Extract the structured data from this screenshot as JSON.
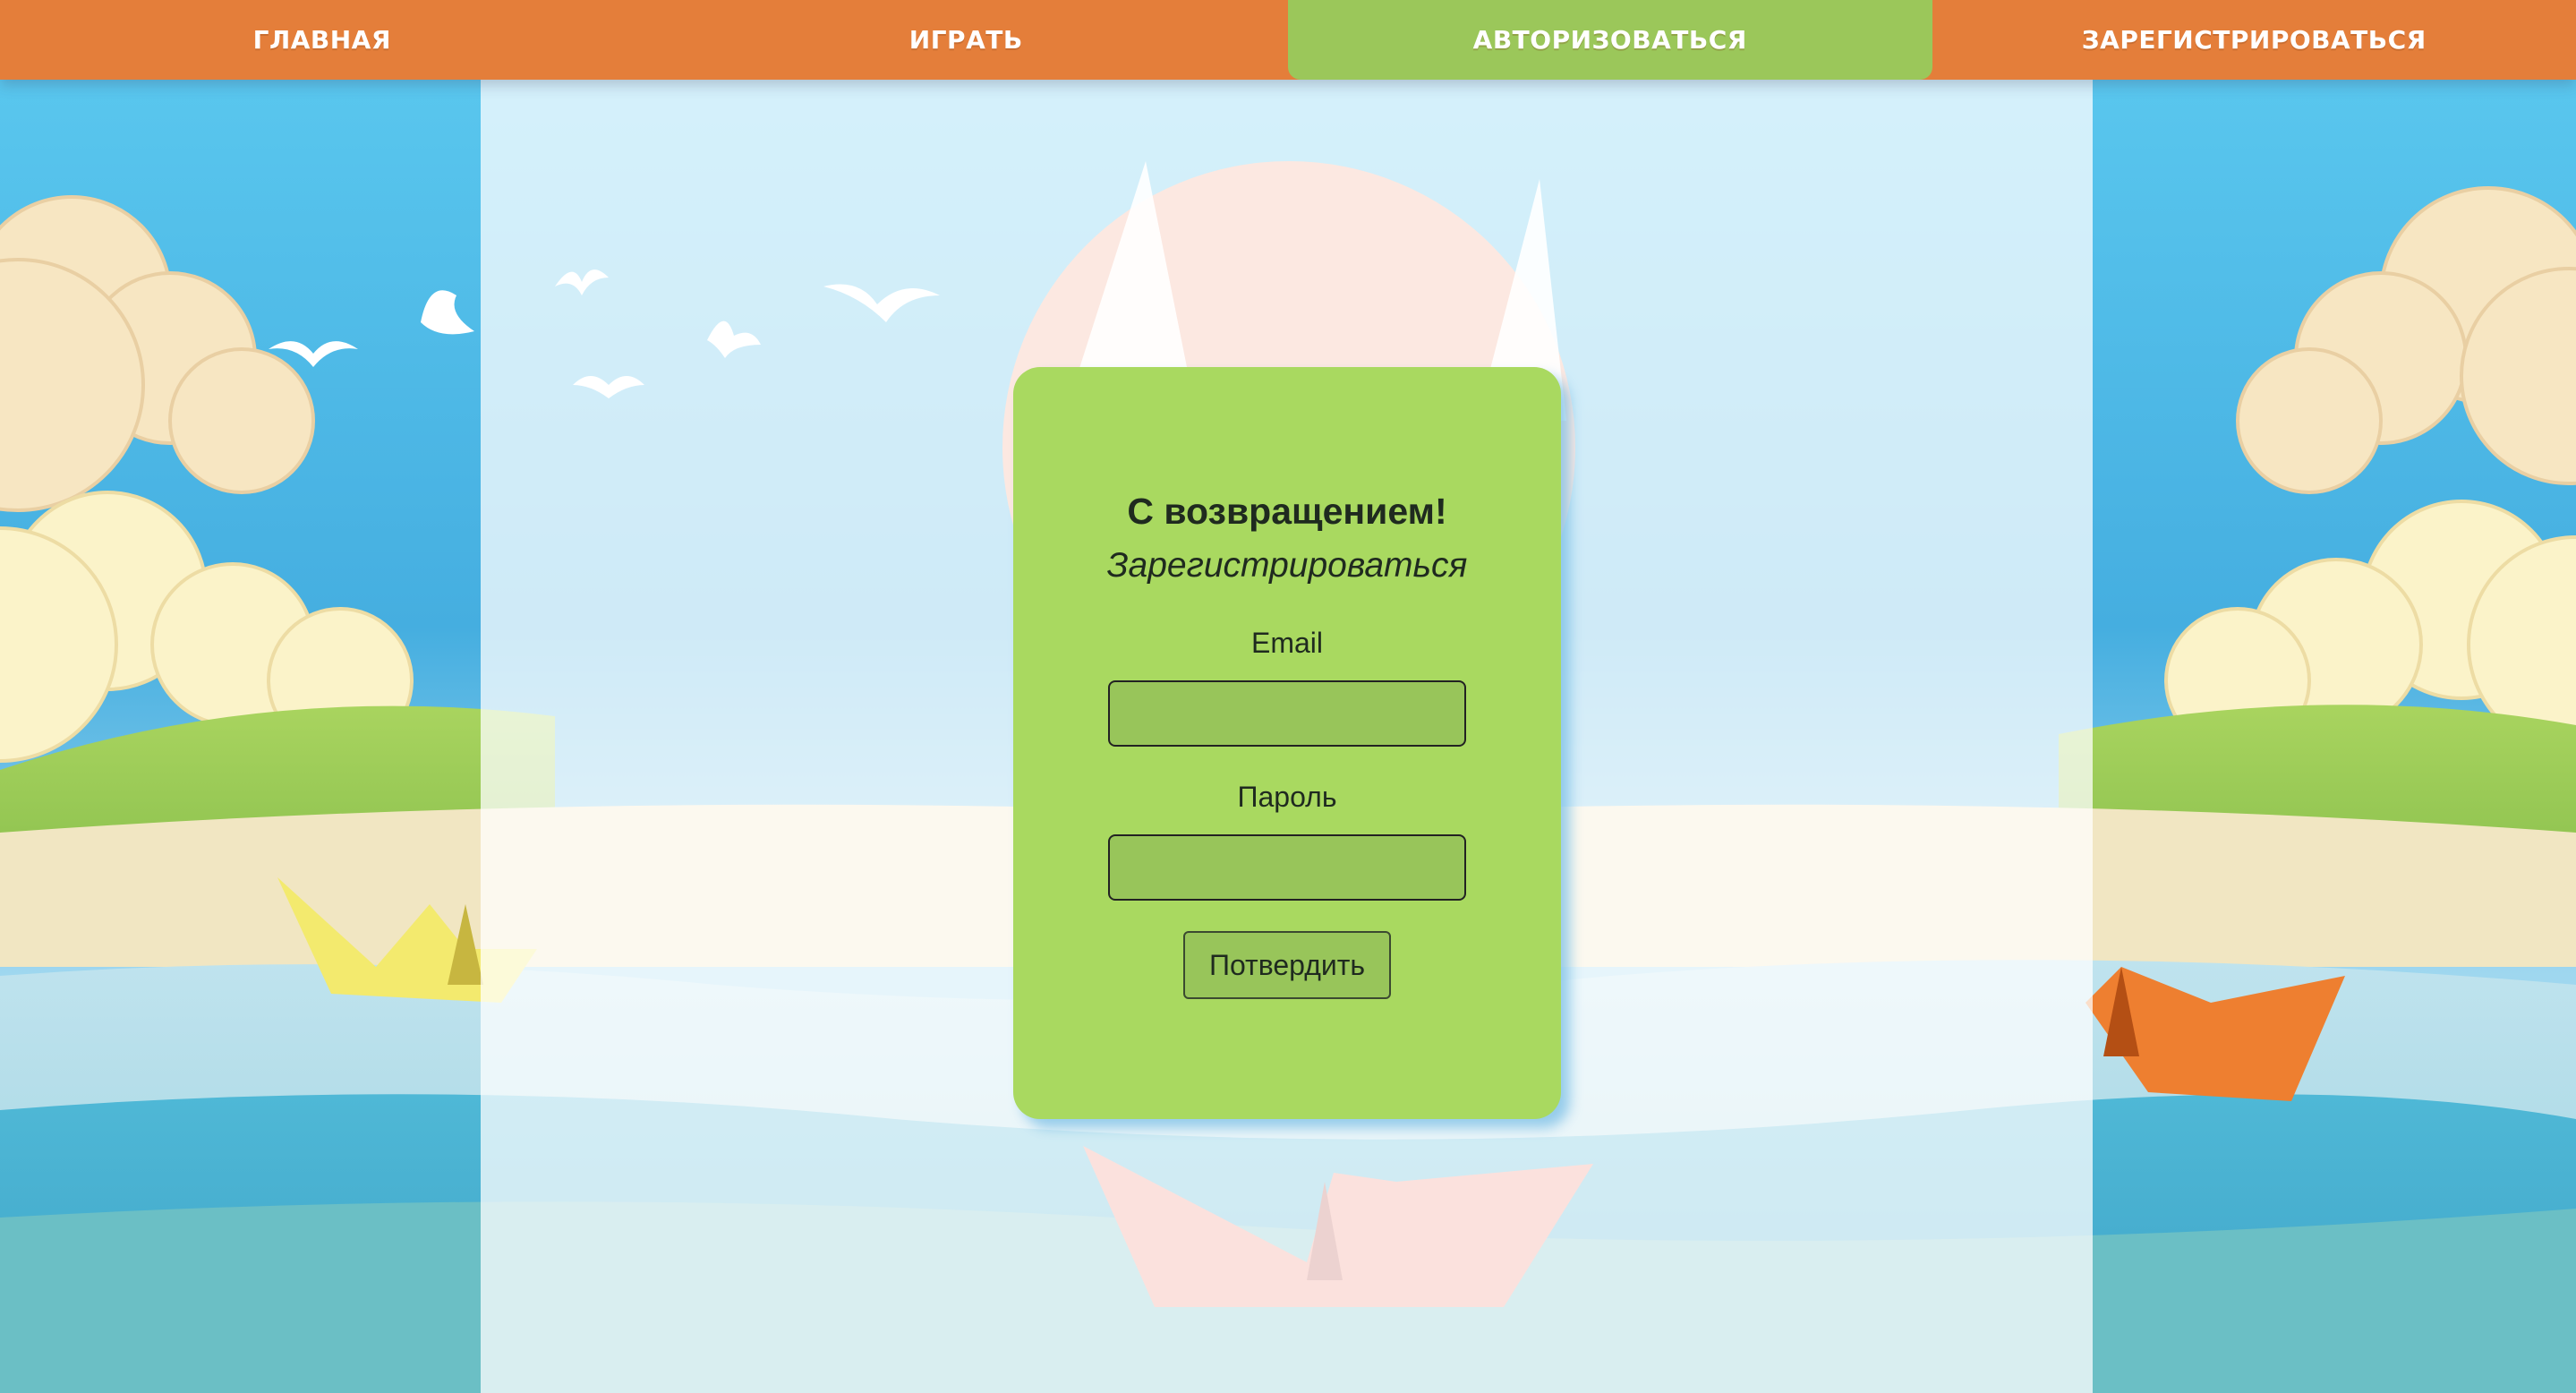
{
  "nav": {
    "items": [
      {
        "label": "Главная"
      },
      {
        "label": "Играть"
      },
      {
        "label": "Авторизоваться"
      },
      {
        "label": "Зарегистрироваться"
      }
    ],
    "active_index": 2
  },
  "login": {
    "title": "С возвращением!",
    "register_link": "Зарегистрироваться",
    "email_label": "Email",
    "email_value": "",
    "password_label": "Пароль",
    "password_value": "",
    "submit_label": "Потвердить"
  },
  "colors": {
    "nav_bg": "#e47e3a",
    "nav_active": "#9bc75a",
    "card_bg": "#a9d960",
    "input_bg": "#98c55a"
  },
  "icons": [
    "seagull-icon",
    "paper-boat-icon",
    "sailboat-icon",
    "sun-icon",
    "cloud-icon"
  ]
}
